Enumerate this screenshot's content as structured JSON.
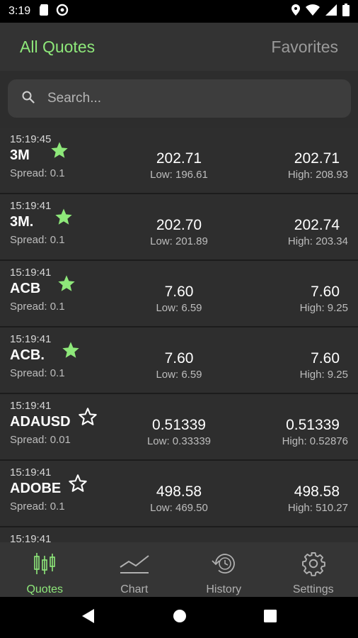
{
  "status_bar": {
    "time": "3:19"
  },
  "tabs": {
    "active": "All Quotes",
    "inactive": "Favorites"
  },
  "search": {
    "placeholder": "Search..."
  },
  "colors": {
    "accent": "#8ee87a",
    "background": "#2e2e2e",
    "star_filled": "#8ee87a",
    "star_outline": "#ffffff"
  },
  "quotes": [
    {
      "time": "15:19:45",
      "symbol": "3M",
      "spread": "Spread: 0.1",
      "favorite": true,
      "bid": "202.71",
      "low": "Low: 196.61",
      "ask": "202.71",
      "high": "High: 208.93"
    },
    {
      "time": "15:19:41",
      "symbol": "3M.",
      "spread": "Spread: 0.1",
      "favorite": true,
      "bid": "202.70",
      "low": "Low: 201.89",
      "ask": "202.74",
      "high": "High: 203.34"
    },
    {
      "time": "15:19:41",
      "symbol": "ACB",
      "spread": "Spread: 0.1",
      "favorite": true,
      "bid": "7.60",
      "low": "Low: 6.59",
      "ask": "7.60",
      "high": "High: 9.25"
    },
    {
      "time": "15:19:41",
      "symbol": "ACB.",
      "spread": "Spread: 0.1",
      "favorite": true,
      "bid": "7.60",
      "low": "Low: 6.59",
      "ask": "7.60",
      "high": "High: 9.25"
    },
    {
      "time": "15:19:41",
      "symbol": "ADAUSD",
      "spread": "Spread: 0.01",
      "favorite": false,
      "bid": "0.51339",
      "low": "Low: 0.33339",
      "ask": "0.51339",
      "high": "High: 0.52876"
    },
    {
      "time": "15:19:41",
      "symbol": "ADOBE",
      "spread": "Spread: 0.1",
      "favorite": false,
      "bid": "498.58",
      "low": "Low: 469.50",
      "ask": "498.58",
      "high": "High: 510.27"
    },
    {
      "time": "15:19:41",
      "symbol": "",
      "spread": "",
      "favorite": false,
      "bid": "",
      "low": "",
      "ask": "",
      "high": ""
    }
  ],
  "bottom_nav": {
    "quotes": "Quotes",
    "chart": "Chart",
    "history": "History",
    "settings": "Settings"
  }
}
